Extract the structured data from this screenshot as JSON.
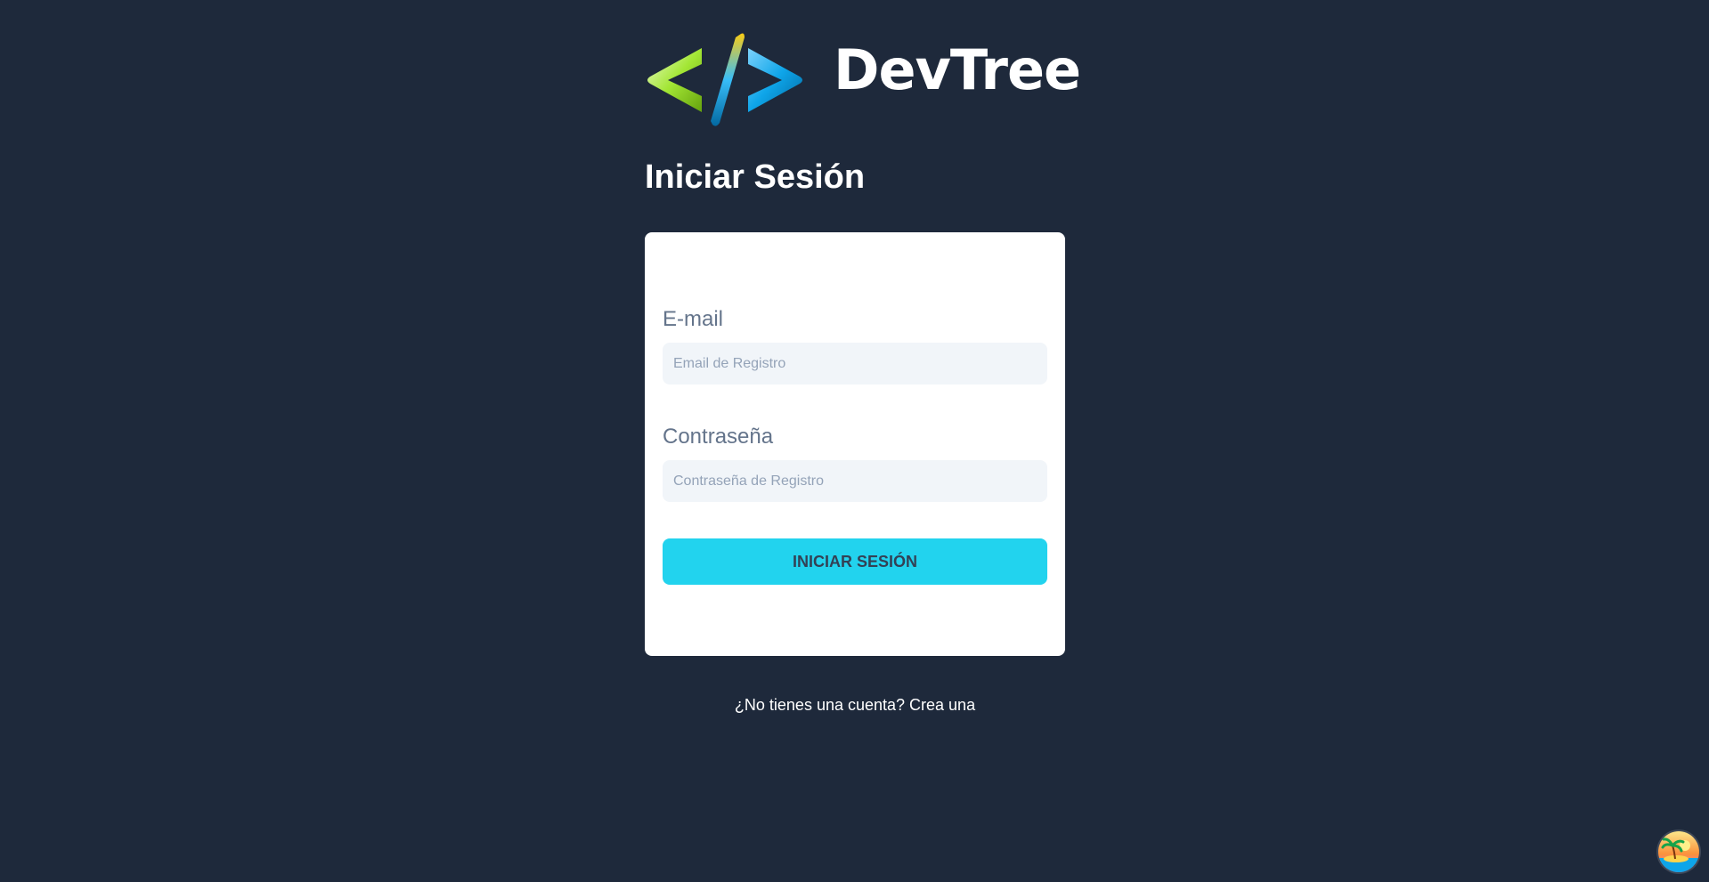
{
  "brand": {
    "name": "DevTree",
    "logo_icon": "code-brackets-icon",
    "logo_colors": [
      "#d9f99d",
      "#84cc16",
      "#38bdf8",
      "#0284c7"
    ]
  },
  "page": {
    "title": "Iniciar Sesión",
    "background": "#1e293b"
  },
  "form": {
    "email": {
      "label": "E-mail",
      "value": "",
      "placeholder": "Email de Registro"
    },
    "password": {
      "label": "Contraseña",
      "value": "",
      "placeholder": "Contraseña de Registro"
    },
    "submit_label": "Iniciar Sesión",
    "submit_color": "#22d3ee"
  },
  "footer": {
    "register_link": "¿No tienes una cuenta? Crea una"
  },
  "corner": {
    "icon": "island-avatar-icon"
  }
}
